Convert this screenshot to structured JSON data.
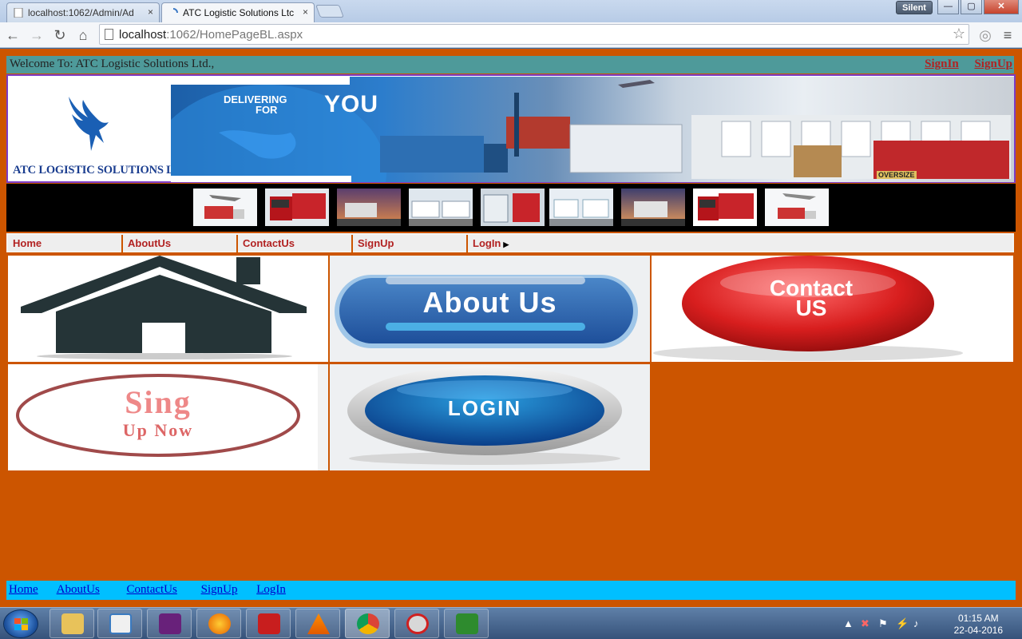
{
  "browser": {
    "tabs": [
      {
        "title": "localhost:1062/Admin/Ad",
        "close": "×"
      },
      {
        "title": "ATC Logistic Solutions Ltc",
        "close": "×"
      }
    ],
    "silent_label": "Silent",
    "window_buttons": {
      "minimize": "—",
      "maximize": "▢",
      "close": "✕"
    },
    "nav": {
      "back": "←",
      "forward": "→",
      "reload": "↻",
      "home": "⌂"
    },
    "address": {
      "host": "localhost",
      "path": ":1062/HomePageBL.aspx"
    },
    "star": "☆",
    "menu_icon": "≡"
  },
  "header": {
    "welcome": "Welcome To: ATC Logistic Solutions Ltd.,",
    "signin": "SignIn",
    "signup": "SignUp"
  },
  "banner": {
    "logo_text": "ATC LOGISTIC SOLUTIONS LTD.,",
    "slogan_small_1": "DELIVERING",
    "slogan_small_2": "FOR",
    "slogan_big": "YOU",
    "oversize_label": "OVERSIZE"
  },
  "thumbnails": [
    "plane-truck",
    "red-truck",
    "sunset-truck",
    "white-trucks",
    "truck-pair",
    "white-trucks",
    "sunset-truck",
    "red-truck",
    "plane-truck"
  ],
  "menu": {
    "items": [
      {
        "label": "Home"
      },
      {
        "label": "AboutUs"
      },
      {
        "label": "ContactUs"
      },
      {
        "label": "SignUp"
      },
      {
        "label": "LogIn",
        "arrow": "▶"
      }
    ]
  },
  "tiles": {
    "about_text": "About Us",
    "contact_line1": "Contact",
    "contact_line2": "US",
    "signup_line1": "Sing",
    "signup_line2": "Up Now",
    "login_text": "LOGIN"
  },
  "footer": {
    "links": [
      "Home",
      "AboutUs",
      "ContactUs",
      "SignUp",
      "LogIn"
    ]
  },
  "taskbar": {
    "time": "01:15 AM",
    "date": "22-04-2016",
    "apps": [
      "file-explorer",
      "media-player",
      "visual-studio",
      "firefox",
      "acrobat",
      "vlc",
      "chrome",
      "ccleaner",
      "sd-app"
    ]
  }
}
